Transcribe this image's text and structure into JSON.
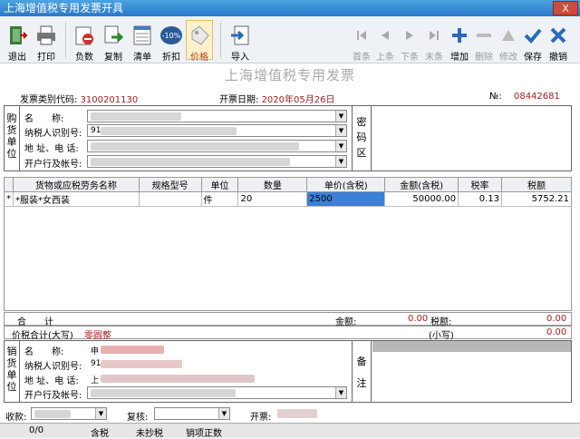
{
  "window": {
    "title": "上海增值税专用发票开具",
    "close": "X"
  },
  "toolbar": {
    "exit": "退出",
    "print": "打印",
    "negative": "负数",
    "copy": "复制",
    "list": "清单",
    "discount": "折扣",
    "discount_badge": "-10%",
    "price": "价格",
    "import": "导入",
    "first": "首条",
    "prev": "上条",
    "next": "下条",
    "last": "末条",
    "add": "增加",
    "delete": "删除",
    "modify": "修改",
    "save": "保存",
    "cancel": "撤销"
  },
  "invoice": {
    "title": "上海增值税专用发票",
    "type_code_label": "发票类别代码:",
    "type_code": "3100201130",
    "date_label": "开票日期:",
    "date": "2020年05月26日",
    "no_label": "№:",
    "no": "08442681"
  },
  "buyer": {
    "side_label": "购货单位",
    "name_label": "名　　称:",
    "taxid_label": "纳税人识别号:",
    "addr_label": "地 址、电 话:",
    "bank_label": "开户行及帐号:",
    "taxid_partial": "91"
  },
  "code_area": {
    "label": "密码区"
  },
  "table": {
    "headers": [
      "货物或应税劳务名称",
      "规格型号",
      "单位",
      "数量",
      "单价(含税)",
      "金额(含税)",
      "税率",
      "税额"
    ],
    "rows": [
      {
        "marker": "*",
        "name": "*服装*女西装",
        "spec": "",
        "unit": "件",
        "qty": "20",
        "price": "2500",
        "amount": "50000.00",
        "rate": "0.13",
        "tax": "5752.21"
      }
    ]
  },
  "totals": {
    "total_label": "合　　计",
    "amount_label": "金额:",
    "amount": "0.00",
    "tax_label": "税额:",
    "tax": "0.00",
    "in_words_label": "价税合计(大写)",
    "in_words": "零圆整",
    "small_label": "(小写)",
    "small": "0.00"
  },
  "seller": {
    "side_label": "销货单位",
    "name_label": "名　　称:",
    "taxid_label": "纳税人识别号:",
    "addr_label": "地 址、电 话:",
    "bank_label": "开户行及帐号:",
    "name_partial": "申",
    "taxid_partial": "91",
    "addr_partial": "上"
  },
  "remarks": {
    "label": "备注"
  },
  "footer": {
    "payee_label": "收款:",
    "reviewer_label": "复核:",
    "drawer_label": "开票:"
  },
  "status": {
    "count": "0/0",
    "tax_incl": "含税",
    "unscanned": "未抄税",
    "normal": "销项正数"
  }
}
